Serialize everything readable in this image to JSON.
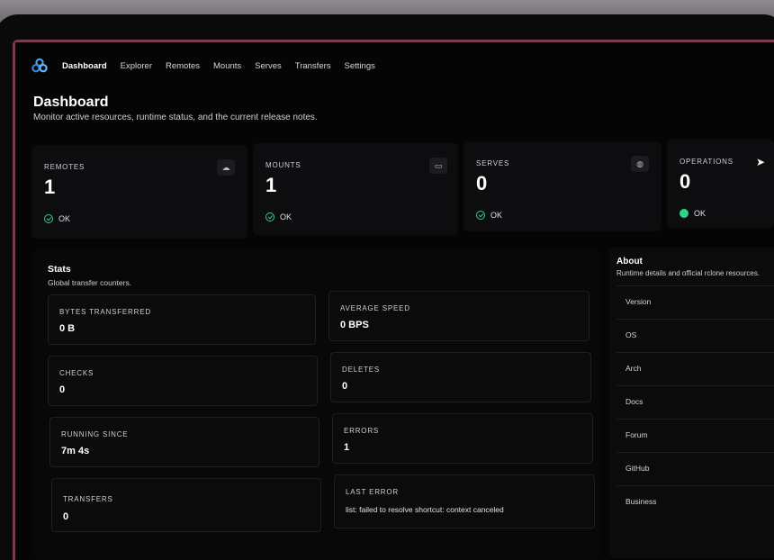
{
  "nav": {
    "items": [
      "Dashboard",
      "Explorer",
      "Remotes",
      "Mounts",
      "Serves",
      "Transfers",
      "Settings"
    ],
    "active": "Dashboard"
  },
  "header": {
    "title": "Dashboard",
    "subtitle": "Monitor active resources, runtime status, and the current release notes."
  },
  "cards": [
    {
      "label": "REMOTES",
      "value": "1",
      "status": "OK",
      "icon": "cloud-icon"
    },
    {
      "label": "MOUNTS",
      "value": "1",
      "status": "OK",
      "icon": "drive-icon"
    },
    {
      "label": "SERVES",
      "value": "0",
      "status": "OK",
      "icon": "globe-icon"
    },
    {
      "label": "OPERATIONS",
      "value": "0",
      "status": "OK",
      "icon": "cursor-icon"
    }
  ],
  "stats": {
    "title": "Stats",
    "subtitle": "Global transfer counters.",
    "items": [
      {
        "label": "BYTES TRANSFERRED",
        "value": "0 B"
      },
      {
        "label": "AVERAGE SPEED",
        "value": "0 BPS"
      },
      {
        "label": "CHECKS",
        "value": "0"
      },
      {
        "label": "DELETES",
        "value": "0"
      },
      {
        "label": "RUNNING SINCE",
        "value": "7m 4s"
      },
      {
        "label": "ERRORS",
        "value": "1"
      },
      {
        "label": "TRANSFERS",
        "value": "0"
      },
      {
        "label": "LAST ERROR",
        "value": "list: failed to resolve shortcut: context canceled"
      }
    ]
  },
  "about": {
    "title": "About",
    "subtitle": "Runtime details and official rclone resources.",
    "rows": [
      "Version",
      "OS",
      "Arch",
      "Docs",
      "Forum",
      "GitHub",
      "Business"
    ]
  },
  "colors": {
    "accent": "#2bd48a",
    "rim": "#7a3a52",
    "logo": "#4aa3f0"
  }
}
